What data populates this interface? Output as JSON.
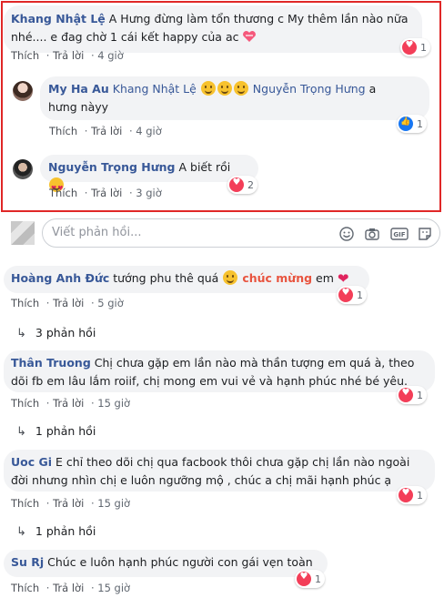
{
  "thread": {
    "c1": {
      "name": "Khang Nhật Lệ",
      "text1": "A Hưng đừng làm tổn thương c My thêm lần nào nữa",
      "text2": "nhé.... e đag chờ 1 cái kết happy của ac",
      "react_count": "1",
      "like": "Thích",
      "reply": "Trả lời",
      "time": "4 giờ"
    },
    "r1": {
      "name": "My Ha Au",
      "mention1": "Khang Nhật Lệ",
      "mention2": "Nguyễn Trọng Hưng",
      "text_a": "a",
      "text2": "hưng nàyy",
      "react_count": "1",
      "like": "Thích",
      "reply": "Trả lời",
      "time": "4 giờ"
    },
    "r2": {
      "name": "Nguyễn Trọng Hưng",
      "text": "A biết rồi",
      "react_count": "2",
      "like": "Thích",
      "reply": "Trả lời",
      "time": "3 giờ"
    }
  },
  "reply_box": {
    "placeholder": "Viết phản hồi..."
  },
  "comments": [
    {
      "name": "Hoàng Anh Đức",
      "text1": "tướng phu thê quá",
      "highlight": "chúc mừng",
      "text2": "em",
      "react_count": "1",
      "like": "Thích",
      "reply": "Trả lời",
      "time": "5 giờ",
      "replies": "3 phản hồi"
    },
    {
      "name": "Thân Truong",
      "text1": "Chị chưa gặp em lần nào mà thần tượng em quá à, theo",
      "text2": "dõi fb em lâu lắm roiif, chị mong em vui vẻ và hạnh phúc nhé bé yêu.",
      "react_count": "1",
      "like": "Thích",
      "reply": "Trả lời",
      "time": "15 giờ",
      "replies": "1 phản hồi"
    },
    {
      "name": "Uoc Gi",
      "text1": "E chỉ theo dõi chị qua facbook thôi chưa gặp chị lần nào ngoài",
      "text2": "đời nhưng nhìn chị e luôn ngưỡng mộ , chúc a chị mãi hạnh phúc ạ",
      "react_count": "1",
      "like": "Thích",
      "reply": "Trả lời",
      "time": "15 giờ",
      "replies": "1 phản hồi"
    },
    {
      "name": "Su Rj",
      "text1": "Chúc e luôn hạnh phúc người con gái vẹn toàn",
      "react_count": "1",
      "like": "Thích",
      "reply": "Trả lời",
      "time": "15 giờ"
    }
  ],
  "colors": {
    "highlight_border": "#e02727",
    "name": "#385898",
    "highlight_text": "#e8543f"
  }
}
